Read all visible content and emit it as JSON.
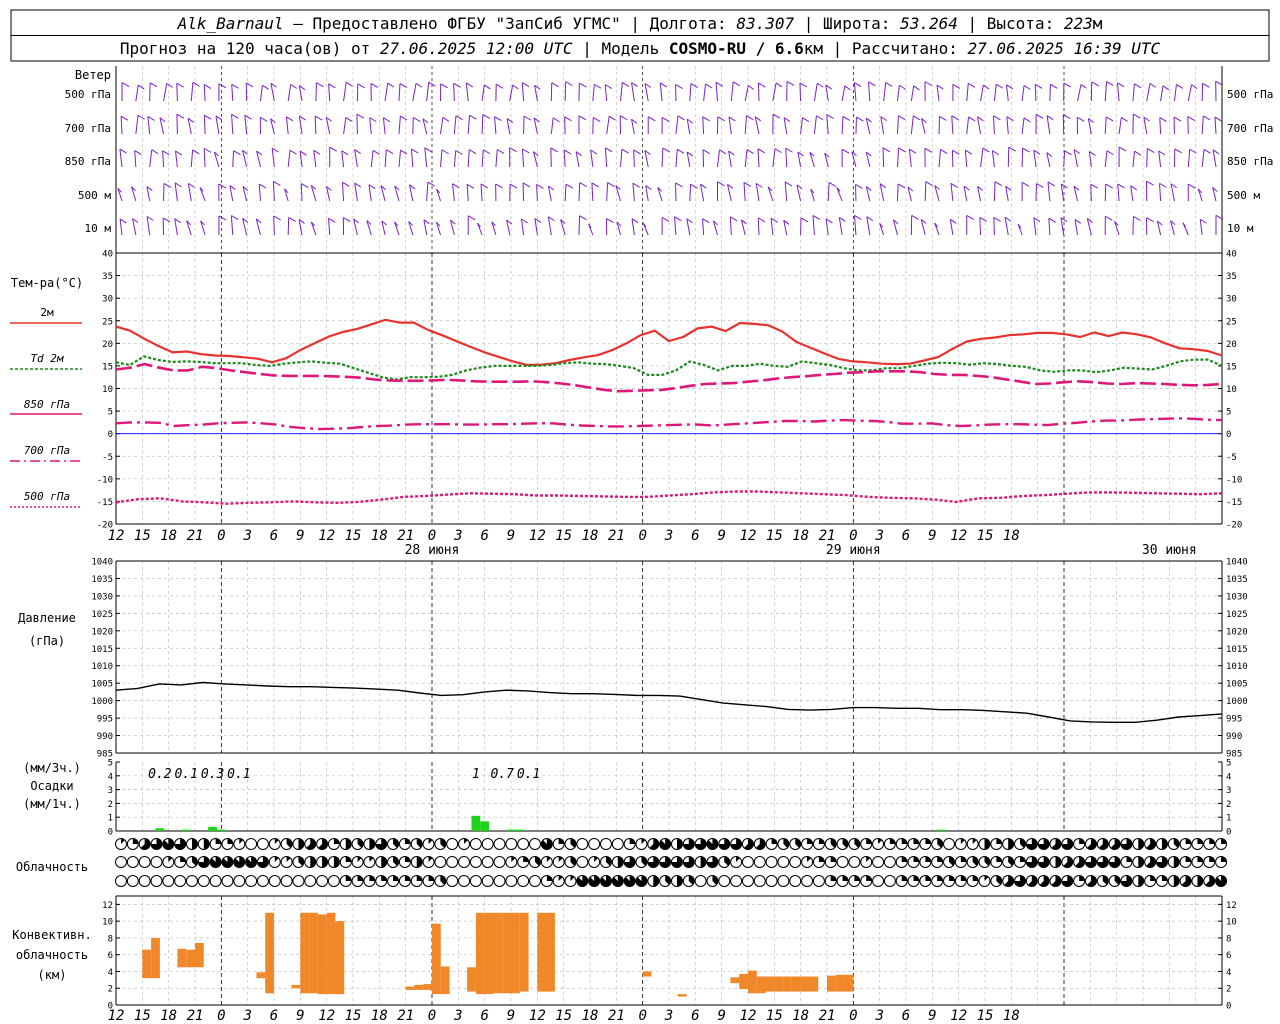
{
  "header": {
    "line1": {
      "station": "Alk_Barnaul",
      "provider": " — Предоставлено ФГБУ \"ЗапСиб УГМС\" | Долгота: ",
      "lon": "83.307",
      "lat_label": " | Широта: ",
      "lat": "53.264",
      "alt_label": " | Высота: ",
      "alt": "223",
      "alt_unit": "м"
    },
    "line2": {
      "prefix": "Прогноз на 120 часа(ов) от ",
      "start": "27.06.2025 12:00 UTC",
      "model_label": "  | Модель ",
      "model": "COSMO-RU / 6.6",
      "model_unit": "км",
      "calc_label": " | Рассчитано: ",
      "calc": "27.06.2025 16:39 UTC"
    }
  },
  "labels": {
    "wind": "Ветер",
    "wind_levels": [
      "500 гПа",
      "700 гПа",
      "850 гПа",
      "500 м",
      "10  м"
    ],
    "temp": "Тем-ра(°C)",
    "legend": [
      "2м",
      "Td  2м",
      "850 гПа",
      "700 гПа",
      "500 гПа"
    ],
    "pressure": [
      "Давление",
      "(гПа)"
    ],
    "precip": [
      "(мм/3ч.)",
      "Осадки",
      "(мм/1ч.)"
    ],
    "cloud": "Облачность",
    "conv": [
      "Конвективн.",
      "облачность",
      "(км)"
    ]
  },
  "colors": {
    "t2m": "#e8322e",
    "td2m": "#1a8a1a",
    "t850": "#e0177a",
    "t700": "#e0177a",
    "t500": "#e0177a",
    "wind": "#7a1fc9",
    "pressure": "#000000",
    "precip": "#1ed31e",
    "conv": "#f0882a",
    "zero_line": "#0000ff",
    "grid": "#bfbfbf"
  },
  "chart_data": {
    "type": "meteogram",
    "x_hours": [
      12,
      15,
      18,
      21,
      0,
      3,
      6,
      9,
      12,
      15,
      18,
      21,
      0,
      3,
      6,
      9,
      12,
      15,
      18,
      21,
      0,
      3,
      6,
      9,
      12,
      15,
      18,
      21,
      0,
      3,
      6,
      9,
      12,
      15,
      18
    ],
    "dates": [
      "28 июня",
      "29 июня",
      "30 июня"
    ],
    "temperature": {
      "ylim": [
        -20,
        40
      ],
      "ticks": [
        40,
        35,
        30,
        25,
        20,
        15,
        10,
        5,
        0,
        -5,
        -10,
        -15,
        -20
      ],
      "series": [
        {
          "key": "t2m",
          "values": [
            23.7,
            22.8,
            21.0,
            19.4,
            18.0,
            18.2,
            17.6,
            17.3,
            17.2,
            16.9,
            16.6,
            15.8,
            16.7,
            18.5,
            20.0,
            21.5,
            22.5,
            23.2,
            24.2,
            25.2,
            24.6,
            24.6,
            23.0,
            21.8,
            20.5,
            19.2,
            18.0,
            17.0,
            16.0,
            15.2,
            15.3,
            15.6,
            16.3,
            16.9,
            17.4,
            18.5,
            20.0,
            21.8,
            22.8,
            20.5,
            21.4,
            23.3,
            23.7,
            22.7,
            24.5,
            24.3,
            24.0,
            22.6,
            20.3,
            19.0,
            17.7,
            16.5,
            16.0,
            15.8,
            15.5,
            15.4,
            15.5,
            16.2,
            17.0,
            18.8,
            20.4,
            21.0,
            21.3,
            21.8,
            22.0,
            22.3,
            22.3,
            22.0,
            21.4,
            22.4,
            21.6,
            22.4,
            22.0,
            21.3,
            20.0,
            18.9,
            18.7,
            18.3,
            17.3
          ]
        },
        {
          "key": "td2m",
          "values": [
            15.8,
            15.2,
            17.1,
            16.3,
            15.9,
            16.0,
            15.9,
            15.6,
            15.6,
            15.6,
            15.2,
            15.0,
            15.5,
            15.8,
            16.0,
            15.7,
            15.5,
            14.5,
            13.5,
            12.5,
            12.0,
            12.5,
            12.5,
            12.6,
            13.0,
            14.0,
            14.6,
            15.0,
            15.0,
            15.0,
            15.0,
            15.2,
            15.6,
            15.8,
            15.5,
            15.4,
            15.0,
            14.5,
            13.0,
            13.0,
            14.0,
            16.0,
            15.2,
            14.0,
            15.0,
            15.0,
            15.5,
            15.0,
            14.8,
            16.0,
            15.6,
            15.2,
            14.5,
            14.0,
            14.0,
            14.5,
            14.5,
            15.0,
            15.5,
            15.7,
            15.6,
            15.3,
            15.6,
            15.4,
            15.0,
            14.8,
            14.0,
            13.7,
            14.0,
            14.0,
            13.6,
            14.0,
            14.6,
            14.4,
            14.2,
            15.0,
            16.0,
            16.4,
            16.4,
            15.0
          ]
        },
        {
          "key": "t850",
          "values": [
            14.2,
            14.6,
            15.4,
            14.6,
            14.0,
            14.0,
            14.8,
            14.5,
            14.0,
            13.6,
            13.2,
            12.9,
            12.8,
            12.8,
            12.8,
            12.7,
            12.6,
            12.4,
            12.0,
            11.8,
            11.7,
            11.7,
            11.8,
            11.9,
            11.8,
            11.6,
            11.5,
            11.5,
            11.5,
            11.6,
            11.4,
            11.1,
            10.7,
            10.2,
            9.7,
            9.4,
            9.5,
            9.6,
            9.7,
            10.1,
            10.6,
            11.0,
            11.1,
            11.2,
            11.5,
            11.8,
            12.2,
            12.5,
            12.7,
            13.0,
            13.2,
            13.5,
            13.6,
            13.8,
            13.8,
            13.8,
            13.6,
            13.2,
            13.0,
            13.0,
            12.8,
            12.5,
            12.0,
            11.5,
            11.0,
            11.1,
            11.4,
            11.6,
            11.4,
            11.1,
            11.0,
            11.2,
            11.1,
            11.0,
            10.8,
            10.7,
            10.8,
            11.0
          ]
        },
        {
          "key": "t700",
          "values": [
            2.3,
            2.5,
            2.5,
            2.4,
            1.7,
            1.9,
            2.0,
            2.3,
            2.4,
            2.5,
            2.3,
            2.0,
            1.5,
            1.2,
            1.0,
            1.1,
            1.2,
            1.5,
            1.7,
            1.8,
            2.0,
            2.1,
            2.1,
            2.1,
            2.0,
            2.0,
            2.1,
            2.1,
            2.2,
            2.3,
            2.3,
            2.0,
            1.8,
            1.7,
            1.6,
            1.6,
            1.7,
            1.8,
            1.9,
            2.0,
            2.0,
            1.8,
            2.0,
            2.2,
            2.4,
            2.6,
            2.8,
            2.8,
            2.7,
            2.9,
            3.0,
            2.9,
            2.8,
            2.6,
            2.2,
            2.2,
            2.3,
            1.9,
            1.7,
            1.8,
            2.0,
            2.1,
            2.1,
            2.0,
            1.9,
            2.2,
            2.4,
            2.7,
            2.9,
            2.9,
            3.1,
            3.2,
            3.3,
            3.4,
            3.3,
            3.1,
            3.0
          ]
        },
        {
          "key": "t500",
          "values": [
            -15.2,
            -14.5,
            -14.3,
            -15.0,
            -15.2,
            -15.5,
            -15.3,
            -15.2,
            -15.0,
            -15.2,
            -15.3,
            -15.1,
            -14.6,
            -14.0,
            -13.8,
            -13.5,
            -13.2,
            -13.3,
            -13.4,
            -13.7,
            -13.7,
            -13.8,
            -13.9,
            -14.0,
            -14.0,
            -13.7,
            -13.4,
            -13.0,
            -12.8,
            -12.8,
            -13.0,
            -13.2,
            -13.4,
            -13.6,
            -14.0,
            -14.2,
            -14.3,
            -14.6,
            -15.1,
            -14.3,
            -14.2,
            -13.8,
            -13.6,
            -13.3,
            -13.0,
            -13.0,
            -13.1,
            -13.2,
            -13.3,
            -13.4,
            -13.2
          ]
        }
      ]
    },
    "pressure": {
      "ylim": [
        985,
        1040
      ],
      "ticks": [
        1040,
        1035,
        1030,
        1025,
        1020,
        1015,
        1010,
        1005,
        1000,
        995,
        990,
        985
      ],
      "values": [
        1003.0,
        1003.5,
        1004.8,
        1004.5,
        1005.2,
        1004.8,
        1004.5,
        1004.2,
        1004.0,
        1004.0,
        1003.8,
        1003.6,
        1003.3,
        1003.0,
        1002.2,
        1001.5,
        1001.7,
        1002.5,
        1003.0,
        1002.8,
        1002.3,
        1002.0,
        1002.0,
        1001.8,
        1001.5,
        1001.5,
        1001.3,
        1000.3,
        999.3,
        998.8,
        998.3,
        997.5,
        997.3,
        997.5,
        998.0,
        998.0,
        997.8,
        997.8,
        997.4,
        997.4,
        997.2,
        996.8,
        996.4,
        995.3,
        994.2,
        993.9,
        993.8,
        993.8,
        994.4,
        995.3,
        995.7,
        996.2
      ]
    },
    "precip": {
      "ylim": [
        0,
        5
      ],
      "ticks": [
        5,
        4,
        3,
        2,
        1,
        0
      ],
      "labels": [
        {
          "hour": 5,
          "text": "0.2"
        },
        {
          "hour": 8,
          "text": "0.1"
        },
        {
          "hour": 11,
          "text": "0.3"
        },
        {
          "hour": 14,
          "text": "0.1"
        },
        {
          "hour": 41,
          "text": "1"
        },
        {
          "hour": 44,
          "text": "0.7"
        },
        {
          "hour": 47,
          "text": "0.1"
        }
      ],
      "bars": [
        {
          "hour": 5,
          "value": 0.2
        },
        {
          "hour": 8,
          "value": 0.1
        },
        {
          "hour": 11,
          "value": 0.3
        },
        {
          "hour": 12,
          "value": 0.1
        },
        {
          "hour": 41,
          "value": 1.1
        },
        {
          "hour": 42,
          "value": 0.7
        },
        {
          "hour": 45,
          "value": 0.1
        },
        {
          "hour": 46,
          "value": 0.1
        },
        {
          "hour": 94,
          "value": 0.1
        }
      ]
    },
    "cloud_cover": {
      "rows": [
        [
          1,
          2,
          5,
          6,
          7,
          6,
          4,
          4,
          2,
          2,
          1,
          0,
          0,
          1,
          3,
          4,
          5,
          5,
          2,
          4,
          3,
          4,
          6,
          3,
          2,
          3,
          1,
          3,
          0,
          1,
          0,
          0,
          0,
          0,
          0,
          0,
          7,
          2,
          3,
          0,
          0,
          0,
          0,
          2,
          1,
          5,
          7,
          4,
          6,
          6,
          7,
          6,
          6,
          5,
          5,
          2,
          3,
          3,
          2,
          2,
          3,
          3,
          3,
          2,
          1,
          2,
          2,
          2,
          2,
          3,
          0,
          1,
          1,
          4,
          2,
          4,
          3,
          6,
          6,
          5,
          6,
          2,
          5,
          5,
          5,
          6,
          4,
          5,
          4,
          3,
          2,
          2,
          2,
          2
        ],
        [
          0,
          0,
          0,
          0,
          1,
          2,
          3,
          6,
          7,
          7,
          7,
          7,
          6,
          1,
          1,
          3,
          4,
          4,
          4,
          2,
          1,
          1,
          4,
          3,
          2,
          4,
          1,
          0,
          0,
          0,
          0,
          0,
          0,
          1,
          2,
          3,
          1,
          1,
          3,
          0,
          1,
          3,
          4,
          6,
          3,
          6,
          6,
          6,
          6,
          4,
          6,
          3,
          1,
          0,
          0,
          0,
          0,
          0,
          1,
          2,
          2,
          0,
          0,
          1,
          0,
          0,
          2,
          2,
          2,
          2,
          3,
          2,
          3,
          3,
          2,
          3,
          2,
          6,
          6,
          4,
          5,
          5,
          6,
          6,
          6,
          2,
          4,
          5,
          6,
          4,
          2,
          2,
          2,
          2
        ],
        [
          0,
          0,
          0,
          0,
          0,
          0,
          0,
          0,
          0,
          0,
          0,
          0,
          0,
          0,
          0,
          0,
          0,
          0,
          0,
          2,
          2,
          2,
          2,
          2,
          2,
          2,
          2,
          3,
          0,
          0,
          0,
          0,
          0,
          0,
          0,
          0,
          2,
          1,
          1,
          7,
          7,
          7,
          7,
          7,
          7,
          4,
          3,
          4,
          3,
          0,
          3,
          0,
          0,
          0,
          0,
          0,
          0,
          0,
          0,
          0,
          2,
          2,
          2,
          2,
          0,
          0,
          2,
          2,
          2,
          2,
          2,
          2,
          2,
          1,
          3,
          5,
          6,
          5,
          5,
          5,
          6,
          2,
          5,
          3,
          3,
          6,
          4,
          2,
          2,
          4,
          5,
          4,
          5,
          7
        ]
      ]
    },
    "convective": {
      "ylim": [
        0,
        13
      ],
      "ticks": [
        12,
        10,
        8,
        6,
        4,
        2,
        0
      ],
      "bars": [
        {
          "h0": 3,
          "h1": 4,
          "bottom": 3.2,
          "top": 6.6
        },
        {
          "h0": 4,
          "h1": 5,
          "bottom": 3.2,
          "top": 8.0
        },
        {
          "h0": 7,
          "h1": 8,
          "bottom": 4.5,
          "top": 6.7
        },
        {
          "h0": 8,
          "h1": 9,
          "bottom": 4.5,
          "top": 6.6
        },
        {
          "h0": 9,
          "h1": 10,
          "bottom": 4.5,
          "top": 7.4
        },
        {
          "h0": 16,
          "h1": 17,
          "bottom": 3.2,
          "top": 3.9
        },
        {
          "h0": 17,
          "h1": 18,
          "bottom": 1.4,
          "top": 11.0
        },
        {
          "h0": 20,
          "h1": 21,
          "bottom": 2.0,
          "top": 2.4
        },
        {
          "h0": 21,
          "h1": 22,
          "bottom": 1.4,
          "top": 11.0
        },
        {
          "h0": 22,
          "h1": 23,
          "bottom": 1.4,
          "top": 11.0
        },
        {
          "h0": 23,
          "h1": 24,
          "bottom": 1.3,
          "top": 10.8
        },
        {
          "h0": 24,
          "h1": 25,
          "bottom": 1.3,
          "top": 11.0
        },
        {
          "h0": 25,
          "h1": 26,
          "bottom": 1.3,
          "top": 10.0
        },
        {
          "h0": 33,
          "h1": 34,
          "bottom": 1.8,
          "top": 2.2
        },
        {
          "h0": 34,
          "h1": 35,
          "bottom": 1.8,
          "top": 2.4
        },
        {
          "h0": 35,
          "h1": 36,
          "bottom": 1.8,
          "top": 2.5
        },
        {
          "h0": 36,
          "h1": 37,
          "bottom": 1.3,
          "top": 9.7
        },
        {
          "h0": 37,
          "h1": 38,
          "bottom": 1.3,
          "top": 4.6
        },
        {
          "h0": 40,
          "h1": 41,
          "bottom": 1.6,
          "top": 4.5
        },
        {
          "h0": 41,
          "h1": 42,
          "bottom": 1.3,
          "top": 11.0
        },
        {
          "h0": 42,
          "h1": 43,
          "bottom": 1.3,
          "top": 11.0
        },
        {
          "h0": 43,
          "h1": 44,
          "bottom": 1.4,
          "top": 11.0
        },
        {
          "h0": 44,
          "h1": 45,
          "bottom": 1.4,
          "top": 11.0
        },
        {
          "h0": 45,
          "h1": 46,
          "bottom": 1.4,
          "top": 11.0
        },
        {
          "h0": 46,
          "h1": 47,
          "bottom": 1.6,
          "top": 11.0
        },
        {
          "h0": 48,
          "h1": 50,
          "bottom": 1.6,
          "top": 11.0
        },
        {
          "h0": 60,
          "h1": 61,
          "bottom": 3.4,
          "top": 4.0
        },
        {
          "h0": 64,
          "h1": 65,
          "bottom": 1.0,
          "top": 1.3
        },
        {
          "h0": 70,
          "h1": 71,
          "bottom": 2.6,
          "top": 3.3
        },
        {
          "h0": 71,
          "h1": 72,
          "bottom": 1.9,
          "top": 3.7
        },
        {
          "h0": 72,
          "h1": 73,
          "bottom": 1.4,
          "top": 4.1
        },
        {
          "h0": 73,
          "h1": 74,
          "bottom": 1.4,
          "top": 3.4
        },
        {
          "h0": 74,
          "h1": 75,
          "bottom": 1.6,
          "top": 3.4
        },
        {
          "h0": 75,
          "h1": 76,
          "bottom": 1.6,
          "top": 3.4
        },
        {
          "h0": 76,
          "h1": 77,
          "bottom": 1.6,
          "top": 3.4
        },
        {
          "h0": 77,
          "h1": 78,
          "bottom": 1.6,
          "top": 3.4
        },
        {
          "h0": 78,
          "h1": 79,
          "bottom": 1.6,
          "top": 3.4
        },
        {
          "h0": 79,
          "h1": 80,
          "bottom": 1.6,
          "top": 3.4
        },
        {
          "h0": 81,
          "h1": 82,
          "bottom": 1.6,
          "top": 3.5
        },
        {
          "h0": 82,
          "h1": 83,
          "bottom": 1.6,
          "top": 3.6
        },
        {
          "h0": 83,
          "h1": 84,
          "bottom": 1.6,
          "top": 3.6
        }
      ]
    },
    "wind_barb_count": 80
  }
}
